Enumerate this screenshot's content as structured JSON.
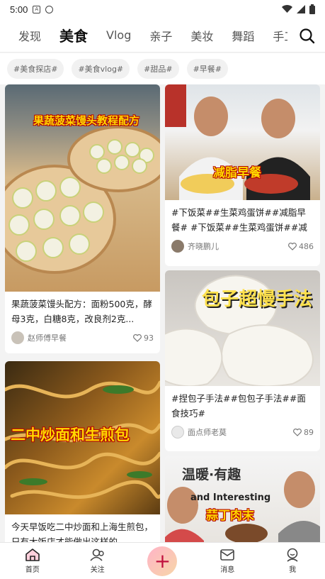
{
  "status": {
    "time": "5:00"
  },
  "tabs": [
    {
      "label": "发现",
      "active": false
    },
    {
      "label": "美食",
      "active": true
    },
    {
      "label": "Vlog",
      "active": false
    },
    {
      "label": "亲子",
      "active": false
    },
    {
      "label": "美妆",
      "active": false
    },
    {
      "label": "舞蹈",
      "active": false
    },
    {
      "label": "手工",
      "active": false
    }
  ],
  "chips": [
    "#美食探店#",
    "#美食vlog#",
    "#甜品#",
    "#早餐#"
  ],
  "cards": [
    {
      "overlay": "果蔬菠菜馒头教程配方",
      "title": "果蔬菠菜馒头配方：面粉500克，酵母3克，白糖8克，改良剂2克...",
      "author": "赵师傅早餐",
      "likes": "93"
    },
    {
      "overlay": "二中炒面和生煎包",
      "title": "今天早饭吃二中炒面和上海生煎包，只有大饭店才能做出这样的...",
      "author": "",
      "likes": ""
    },
    {
      "overlay": "减脂早餐",
      "title": "#下饭菜##生菜鸡蛋饼##减脂早餐# #下饭菜##生菜鸡蛋饼##减脂...",
      "author": "齐晓鹏儿",
      "likes": "486"
    },
    {
      "overlay": "包子超慢手法",
      "title": "#捏包子手法##包包子手法##面食技巧#",
      "author": "面点师老莫",
      "likes": "89"
    },
    {
      "overlay": "温暖·有趣",
      "overlay2": "and Interesting",
      "overlay3": "蒜丁肉末",
      "title": "",
      "author": "",
      "likes": ""
    }
  ],
  "bottom": {
    "home": "首页",
    "follow": "关注",
    "plus": "+",
    "messages": "消息",
    "me": "我"
  },
  "colors": {
    "accent": "#e8294f",
    "overlay_text": "#ffd800"
  }
}
